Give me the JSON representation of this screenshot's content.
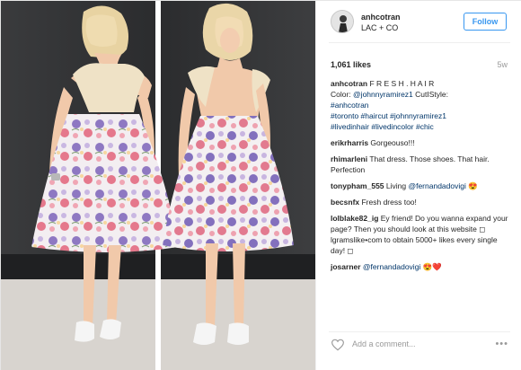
{
  "header": {
    "username": "anhcotran",
    "location": "LAC + CO",
    "follow_label": "Follow"
  },
  "meta": {
    "likes": "1,061 likes",
    "time": "5w"
  },
  "caption": {
    "user": "anhcotran",
    "text_1": " F R E S H . H A I R",
    "text_2": "Color: ",
    "mention_1": "@johnnyramirez1",
    "text_3": " CutIStyle:",
    "mention_2": "#anhcotran",
    "hashtags_1": "#toronto #haircut #johnnyramirez1",
    "hashtags_2": "#livedinhair #livedincolor #chic"
  },
  "comments": [
    {
      "user": "erikrharris",
      "text": " Gorgeouso!!!"
    },
    {
      "user": "rhimarleni",
      "text": " That dress. Those shoes. That hair. Perfection"
    },
    {
      "user": "tonypham_555",
      "text_before": " Living ",
      "mention": "@fernandadovigi",
      "text_after": " 😍"
    },
    {
      "user": "becsnfx",
      "text": " Fresh dress too!"
    },
    {
      "user": "lolblake82_ig",
      "text": " Ey friend! Do you wanna expand your page? Then you should look at this website ◻ lgramslike•com to obtain 5000+ likes every single day! ◻"
    },
    {
      "user": "josarner",
      "mention": "@fernandadovigi",
      "text_after": " 😍❤️"
    }
  ],
  "footer": {
    "add_comment_placeholder": "Add a comment...",
    "more_label": "•••"
  },
  "icons": {
    "heart": "heart-icon",
    "more": "more-options-icon",
    "avatar": "avatar"
  },
  "colors": {
    "link": "#003569",
    "follow_blue": "#3897f0",
    "muted": "#999999"
  }
}
